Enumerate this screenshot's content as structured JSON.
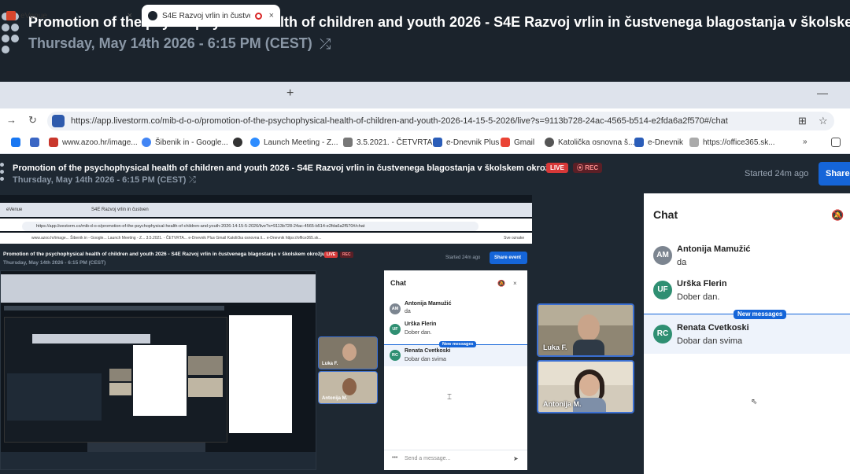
{
  "event": {
    "title": "Promotion of the psychophysical health of children and youth 2026 - S4E Razvoj vrlin in čustvenega blagostanja v školskem okrožju",
    "title_truncated": "Promotion of the psychophysical health of children and youth 2026 - S4E Razvoj vrlin in čustvenega blagostanja v školskem",
    "date": "Thursday, May 14th 2026 - 6:15 PM (CEST)",
    "live_badge": "LIVE",
    "rec_badge": "REC",
    "started": "Started 24m ago",
    "share_label": "Share"
  },
  "browser": {
    "tabs": [
      {
        "label": "eVenue",
        "close": "×"
      },
      {
        "label": "S4E Razvoj vrlin in čustvenc",
        "close": "×"
      }
    ],
    "new_tab": "+",
    "url": "https://app.livestorm.co/mib-d-o-o/promotion-of-the-psychophysical-health-of-children-and-youth-2026-14-15-5-2026/live?s=9113b728-24ac-4565-b514-e2fda6a2f570#/chat",
    "bookmarks": [
      "www.azoo.hr/image...",
      "Šibenik in - Google...",
      "Launch Meeting - Z...",
      "3.5.2021. - ČETVRTA...",
      "e-Dnevnik Plus",
      "Gmail",
      "Katolička osnovna š...",
      "e-Dnevnik",
      "https://office365.sk..."
    ],
    "bookmarks_more": "»"
  },
  "shared_screen": {
    "tabs": [
      "eVenue",
      "S4E Razvoj vrlin in čustven"
    ],
    "url": "https://app.livestorm.co/mib-d-o-o/promotion-of-the-psychophysical-health-of-children-and-youth-2026-14-15-5-2026/live?s=9113b728-24ac-4565-b514-e2fda6a2f570#/chat",
    "bookmarks": "www.azoo.hr/image...   Šibenik in - Google...   Launch Meeting - Z...   3.5.2021. - ČETVRTA...   e-Dnevnik Plus   Gmail   Katolička osnovna š...   e-Dnevnik   https://office365.sk...",
    "bookmarks_right": "Sve oznake",
    "title": "Promotion of the psychophysical health of children and youth 2026 - S4E Razvoj vrlin in čustvenega blagostanja v školskem okrožju",
    "date": "Thursday, May 14th 2026 - 6:15 PM (CEST)",
    "started": "Started 24m ago",
    "share_label": "Share event",
    "chat_title": "Chat",
    "messages": [
      {
        "initials": "AM",
        "name": "Antonija Mamužić",
        "text": "da"
      },
      {
        "initials": "UF",
        "name": "Urška Flerin",
        "text": "Dober dan."
      },
      {
        "initials": "RC",
        "name": "Renata Cvetkoski",
        "text": "Dobar dan svima"
      }
    ],
    "new_messages": "New messages",
    "input_placeholder": "Send a message...",
    "tiles": [
      {
        "name": "Luka F."
      },
      {
        "name": "Antonija M."
      }
    ]
  },
  "video_tiles": [
    {
      "name": "Luka F."
    },
    {
      "name": "Antonija M."
    }
  ],
  "chat": {
    "title": "Chat",
    "new_messages": "New messages",
    "messages": [
      {
        "initials": "AM",
        "name": "Antonija Mamužić",
        "text": "da"
      },
      {
        "initials": "UF",
        "name": "Urška Flerin",
        "text": "Dober dan."
      },
      {
        "initials": "RC",
        "name": "Renata Cvetkoski",
        "text": "Dobar dan svima"
      }
    ]
  },
  "colors": {
    "accent": "#1565d8",
    "live": "#d63838",
    "avatar_green": "#2f8f72",
    "avatar_grey": "#7c8590"
  }
}
